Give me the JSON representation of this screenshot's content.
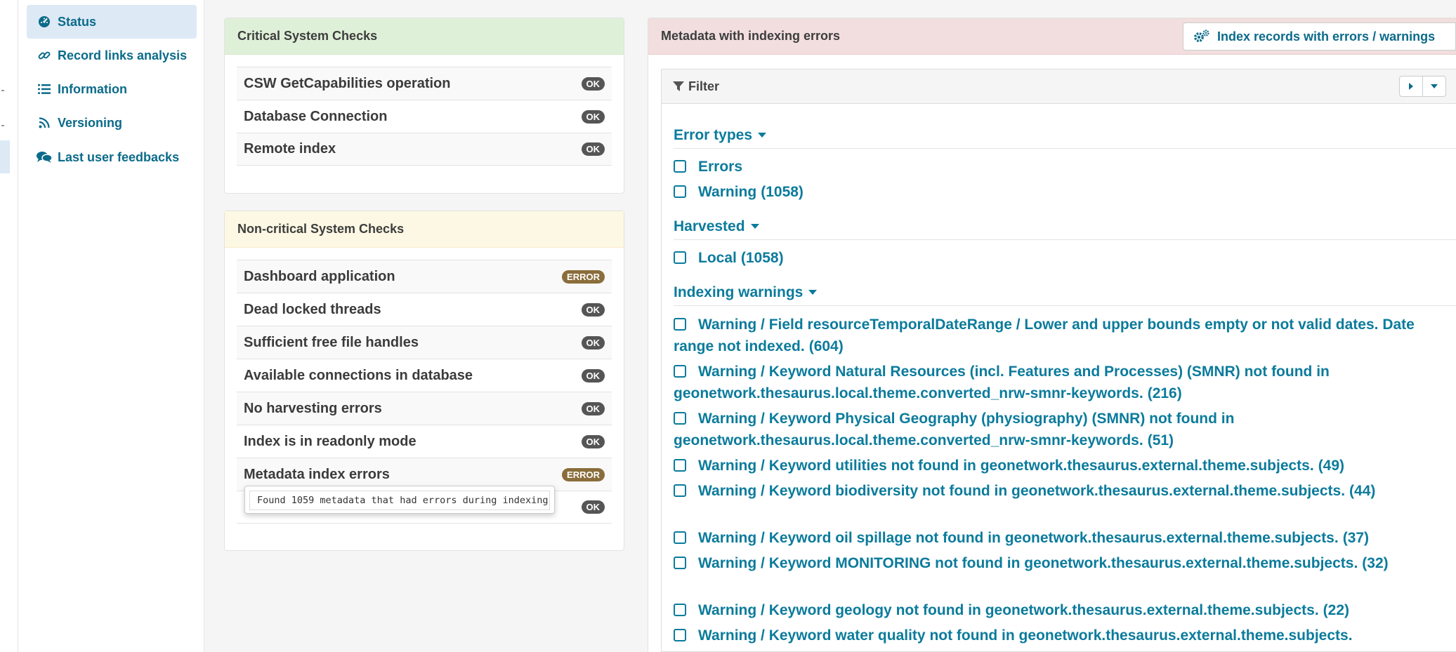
{
  "nav": {
    "items": [
      {
        "label": "Status",
        "icon": "dashboard-icon"
      },
      {
        "label": "Record links analysis",
        "icon": "link-icon"
      },
      {
        "label": "Information",
        "icon": "list-icon"
      },
      {
        "label": "Versioning",
        "icon": "rss-icon"
      },
      {
        "label": "Last user feedbacks",
        "icon": "comments-icon"
      }
    ]
  },
  "critical": {
    "title": "Critical System Checks",
    "checks": [
      {
        "label": "CSW GetCapabilities operation",
        "status": "OK"
      },
      {
        "label": "Database Connection",
        "status": "OK"
      },
      {
        "label": "Remote index",
        "status": "OK"
      }
    ]
  },
  "noncritical": {
    "title": "Non-critical System Checks",
    "checks": [
      {
        "label": "Dashboard application",
        "status": "ERROR"
      },
      {
        "label": "Dead locked threads",
        "status": "OK"
      },
      {
        "label": "Sufficient free file handles",
        "status": "OK"
      },
      {
        "label": "Available connections in database",
        "status": "OK"
      },
      {
        "label": "No harvesting errors",
        "status": "OK"
      },
      {
        "label": "Index is in readonly mode",
        "status": "OK"
      },
      {
        "label": "Metadata index errors",
        "status": "ERROR"
      },
      {
        "label": "",
        "status": "OK"
      }
    ],
    "tooltip": "Found 1059 metadata that had errors during indexing"
  },
  "indexing": {
    "title": "Metadata with indexing errors",
    "index_button": "Index records with errors / warnings",
    "filter_label": "Filter",
    "facets": [
      {
        "title": "Error types",
        "items": [
          {
            "label": "Errors",
            "count": ""
          },
          {
            "label": "Warning",
            "count": "(1058)"
          }
        ]
      },
      {
        "title": "Harvested",
        "items": [
          {
            "label": "Local",
            "count": "(1058)"
          }
        ]
      },
      {
        "title": "Indexing warnings",
        "items": [
          {
            "label": "Warning / Field resourceTemporalDateRange / Lower and upper bounds empty or not valid dates. Date range not indexed.",
            "count": "(604)"
          },
          {
            "label": "Warning / Keyword Natural Resources (incl. Features and Processes) (SMNR) not found in geonetwork.thesaurus.local.theme.converted_nrw-smnr-keywords.",
            "count": "(216)"
          },
          {
            "label": "Warning / Keyword Physical Geography (physiography) (SMNR) not found in geonetwork.thesaurus.local.theme.converted_nrw-smnr-keywords.",
            "count": "(51)"
          },
          {
            "label": "Warning / Keyword utilities not found in geonetwork.thesaurus.external.theme.subjects.",
            "count": "(49)"
          },
          {
            "label": "Warning / Keyword biodiversity not found in geonetwork.thesaurus.external.theme.subjects.",
            "count": "(44)"
          },
          {
            "label": "Warning / Keyword oil spillage not found in geonetwork.thesaurus.external.theme.subjects.",
            "count": "(37)"
          },
          {
            "label": "Warning / Keyword MONITORING not found in geonetwork.thesaurus.external.theme.subjects.",
            "count": "(32)"
          },
          {
            "label": "Warning / Keyword geology not found in geonetwork.thesaurus.external.theme.subjects.",
            "count": "(22)"
          },
          {
            "label": "Warning / Keyword water quality not found in geonetwork.thesaurus.external.theme.subjects.",
            "count": ""
          }
        ]
      }
    ]
  },
  "colors": {
    "accent": "#0b7b9c",
    "critical_header": "#dff0d8",
    "noncritical_header": "#fcf8e3",
    "error_header": "#f2dede",
    "error_badge": "#8a6d3b"
  }
}
